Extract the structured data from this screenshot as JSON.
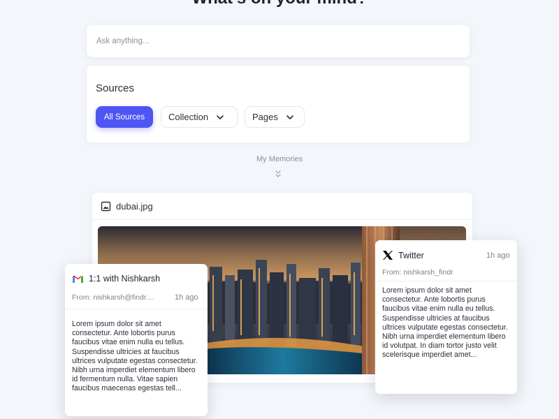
{
  "page": {
    "headline": "What's on your mind?"
  },
  "search": {
    "placeholder": "Ask anything..."
  },
  "sources": {
    "title": "Sources",
    "chips": [
      "All Sources",
      "Collection",
      "Pages"
    ],
    "active_color": "#4f55f2"
  },
  "memories": {
    "label": "My Memories",
    "icon": "double-chevron-down-icon"
  },
  "image_card": {
    "file_name": "dubai.jpg",
    "icon": "image-icon"
  },
  "gmail_card": {
    "icon": "gmail-icon",
    "title": "1:1 with Nishkarsh",
    "from": "From: nishkarsh@findr....",
    "time": "1h ago",
    "body": "Lorem ipsum dolor sit amet consectetur. Ante lobortis purus faucibus vitae enim nulla eu tellus. Suspendisse ultricies at faucibus ultrices vulputate egestas consectetur. Nibh urna imperdiet elementum libero id fermentum nulla. Vitae sapien faucibus maecenas egestas tell..."
  },
  "twitter_card": {
    "icon": "x-logo-icon",
    "title": "Twitter",
    "from": "From: nishkarsh_findr",
    "time": "1h ago",
    "body": "Lorem ipsum dolor sit amet consectetur. Ante lobortis purus faucibus vitae enim nulla eu tellus. Suspendisse ultricies at faucibus ultrices vulputate egestas consectetur. Nibh urna imperdiet elementum libero id volutpat. In diam tortor justo velit scelerisque imperdiet amet..."
  }
}
